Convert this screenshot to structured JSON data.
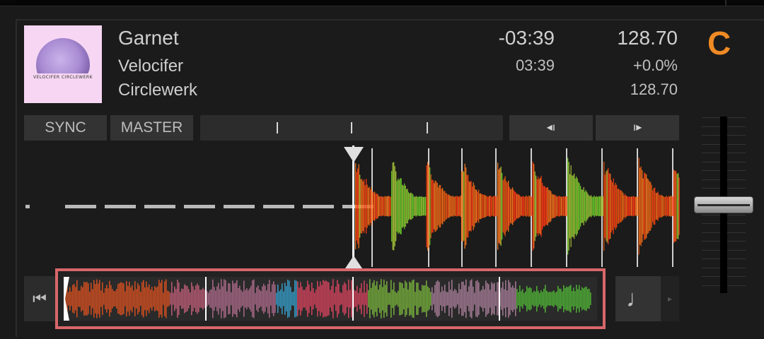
{
  "track": {
    "title": "Garnet",
    "artist": "Velocifer",
    "label": "Circlewerk",
    "cover_text": "VELOCIFER  CIRCLEWERK"
  },
  "time": {
    "remaining": "-03:39",
    "elapsed": "03:39"
  },
  "tempo": {
    "bpm": "128.70",
    "pitch": "+0.0%",
    "original_bpm": "128.70"
  },
  "deck": {
    "letter": "C",
    "accent_color": "#f08a24"
  },
  "buttons": {
    "sync": "SYNC",
    "master": "MASTER",
    "nudge_back": "◂ı",
    "nudge_forward": "ı▸",
    "jump_start": "⏮",
    "quantize": "♩",
    "next": "▸"
  },
  "overview": {
    "highlight_color": "#d8676a",
    "play_position": 0.0
  },
  "icons": [
    "skip-to-start-icon",
    "music-note-icon",
    "nudge-back-icon",
    "nudge-forward-icon",
    "arrow-right-icon"
  ]
}
